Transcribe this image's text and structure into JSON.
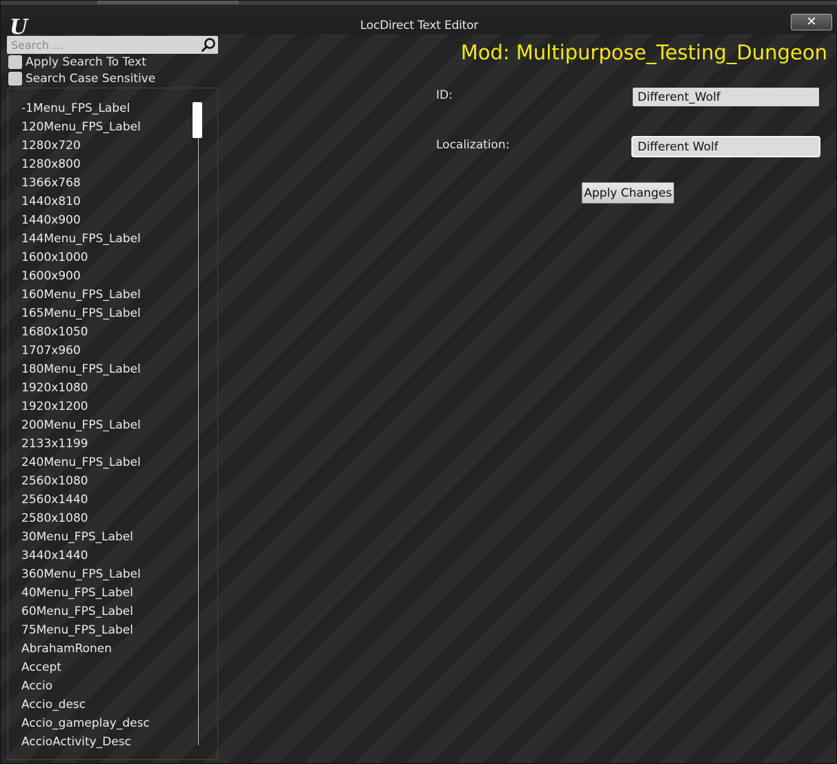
{
  "window": {
    "title": "LocDirect Text Editor",
    "close_glyph": "✕",
    "logo_letter": "U"
  },
  "search": {
    "placeholder": "Search ...",
    "value": "",
    "apply_to_text_label": "Apply Search To Text",
    "apply_to_text_checked": false,
    "case_sensitive_label": "Search Case Sensitive",
    "case_sensitive_checked": false
  },
  "list": {
    "items": [
      "-1Menu_FPS_Label",
      "120Menu_FPS_Label",
      "1280x720",
      "1280x800",
      "1366x768",
      "1440x810",
      "1440x900",
      "144Menu_FPS_Label",
      "1600x1000",
      "1600x900",
      "160Menu_FPS_Label",
      "165Menu_FPS_Label",
      "1680x1050",
      "1707x960",
      "180Menu_FPS_Label",
      "1920x1080",
      "1920x1200",
      "200Menu_FPS_Label",
      "2133x1199",
      "240Menu_FPS_Label",
      "2560x1080",
      "2560x1440",
      "2580x1080",
      "30Menu_FPS_Label",
      "3440x1440",
      "360Menu_FPS_Label",
      "40Menu_FPS_Label",
      "60Menu_FPS_Label",
      "75Menu_FPS_Label",
      "AbrahamRonen",
      "Accept",
      "Accio",
      "Accio_desc",
      "Accio_gameplay_desc",
      "AccioActivity_Desc"
    ]
  },
  "editor": {
    "mod_title": "Mod: Multipurpose_Testing_Dungeon",
    "id_label": "ID:",
    "id_value": "Different_Wolf",
    "localization_label": "Localization:",
    "localization_value": "Different Wolf",
    "apply_button": "Apply Changes"
  },
  "colors": {
    "mod_title": "#f5e71a",
    "list_border": "#5e3a38"
  }
}
